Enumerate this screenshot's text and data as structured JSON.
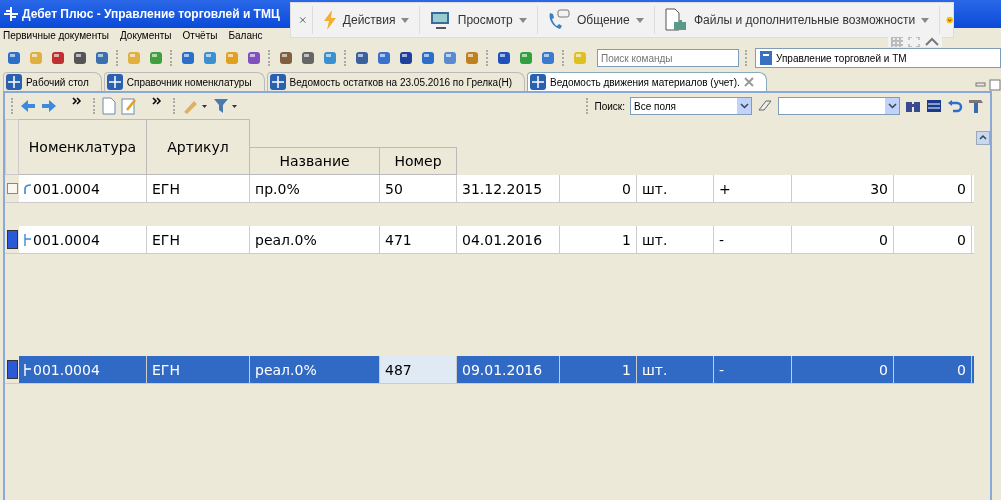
{
  "window": {
    "title": "Дебет Плюс - Управление торговлей и ТМЦ"
  },
  "menu": [
    "Первичные документы",
    "Документы",
    "Отчёты",
    "Баланс"
  ],
  "popup_toolbar": {
    "items": [
      {
        "kind": "actions",
        "label": "Действия"
      },
      {
        "kind": "view",
        "label": "Просмотр"
      },
      {
        "kind": "chat",
        "label": "Общение"
      },
      {
        "kind": "files",
        "label": "Файлы и дополнительные возможности"
      }
    ]
  },
  "toolbar": {
    "command_search": {
      "placeholder": "Поиск команды"
    },
    "window_selector": "Управление торговлей и ТМ"
  },
  "tabs": [
    {
      "label": "Рабочий стол",
      "selected": false,
      "closable": false
    },
    {
      "label": "Справочник номенклатуры",
      "selected": false,
      "closable": false
    },
    {
      "label": "Ведомость остатков на 23.05.2016 по Грелка(Н)",
      "selected": false,
      "closable": false
    },
    {
      "label": "Ведомость движения материалов (учет).",
      "selected": true,
      "closable": true
    }
  ],
  "panel_toolbar": {
    "search_label": "Поиск:",
    "search_field": "Все поля"
  },
  "table": {
    "columns": [
      {
        "label": "Номенклатура",
        "kind": "tall"
      },
      {
        "label": "Артикул",
        "kind": "tall"
      },
      {
        "label": "Название",
        "kind": "short"
      },
      {
        "label": "Номер",
        "kind": "short"
      },
      {
        "kind": "none"
      },
      {
        "kind": "none"
      },
      {
        "kind": "none"
      },
      {
        "kind": "none"
      },
      {
        "kind": "none"
      },
      {
        "kind": "none"
      }
    ],
    "rows": [
      {
        "kind": "receipt",
        "marked": false,
        "selected": false,
        "cells": [
          "001.0004",
          "ЕГН",
          "пр.0%",
          "50",
          "31.12.2015",
          "0",
          "шт.",
          "+",
          "30",
          "0"
        ]
      },
      {
        "kind": "issue",
        "marked": true,
        "selected": false,
        "cells": [
          "001.0004",
          "ЕГН",
          "реал.0%",
          "471",
          "04.01.2016",
          "1",
          "шт.",
          "-",
          "0",
          "0"
        ]
      },
      {
        "kind": "issue",
        "marked": true,
        "selected": true,
        "cells": [
          "001.0004",
          "ЕГН",
          "реал.0%",
          "487",
          "09.01.2016",
          "1",
          "шт.",
          "-",
          "0",
          "0"
        ]
      }
    ]
  }
}
